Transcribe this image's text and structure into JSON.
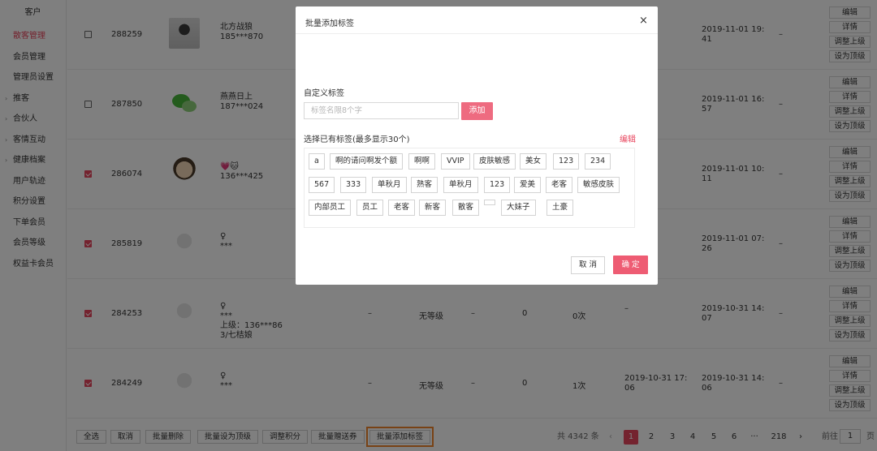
{
  "sidebar": {
    "title": "客户",
    "items": [
      {
        "label": "散客管理",
        "active": true,
        "has_arrow": false
      },
      {
        "label": "会员管理",
        "active": false,
        "has_arrow": false
      },
      {
        "label": "管理员设置",
        "active": false,
        "has_arrow": false
      },
      {
        "label": "推客",
        "active": false,
        "has_arrow": true
      },
      {
        "label": "合伙人",
        "active": false,
        "has_arrow": true
      },
      {
        "label": "客情互动",
        "active": false,
        "has_arrow": true
      },
      {
        "label": "健康档案",
        "active": false,
        "has_arrow": true
      },
      {
        "label": "用户轨迹",
        "active": false,
        "has_arrow": false
      },
      {
        "label": "积分设置",
        "active": false,
        "has_arrow": false
      },
      {
        "label": "下单会员",
        "active": false,
        "has_arrow": false
      },
      {
        "label": "会员等级",
        "active": false,
        "has_arrow": false
      },
      {
        "label": "权益卡会员",
        "active": false,
        "has_arrow": false
      }
    ]
  },
  "rows": [
    {
      "id": "288259",
      "checked": false,
      "avatar": "photo",
      "name": "北方战狼",
      "phone": "185***870",
      "parent": "",
      "parent2": "",
      "level": "",
      "col_a": "",
      "col_b": "",
      "col_c": "",
      "col_d": "",
      "date1": "",
      "date2_line1": "2019-11-01 19:",
      "date2_line2": "41",
      "tail": "–"
    },
    {
      "id": "287850",
      "checked": false,
      "avatar": "wechat",
      "name": "燕燕日上",
      "phone": "187***024",
      "parent": "",
      "parent2": "",
      "level": "",
      "col_a": "",
      "col_b": "",
      "col_c": "",
      "col_d": "",
      "date1": "",
      "date2_line1": "2019-11-01 16:",
      "date2_line2": "57",
      "tail": "–"
    },
    {
      "id": "286074",
      "checked": true,
      "avatar": "cartoon",
      "name": "💗🐱",
      "phone": "136***425",
      "parent": "",
      "parent2": "",
      "level": "",
      "col_a": "",
      "col_b": "",
      "col_c": "",
      "col_d": "",
      "date1": "",
      "date2_line1": "2019-11-01 10:",
      "date2_line2": "11",
      "tail": "–"
    },
    {
      "id": "285819",
      "checked": true,
      "avatar": "blank",
      "name": "♀",
      "phone": "***",
      "parent": "",
      "parent2": "",
      "level": "",
      "col_a": "",
      "col_b": "",
      "col_c": "",
      "col_d": "",
      "date1": "",
      "date2_line1": "2019-11-01 07:",
      "date2_line2": "26",
      "tail": "–"
    },
    {
      "id": "284253",
      "checked": true,
      "avatar": "blank",
      "name": "♀",
      "phone": "***",
      "parent": "上级：136***86",
      "parent2": "3/七桔娘",
      "level": "无等级",
      "col_a": "–",
      "col_b": "–",
      "col_c": "0",
      "col_d": "0次",
      "date1": "–",
      "date2_line1": "2019-10-31 14:",
      "date2_line2": "07",
      "tail": "–"
    },
    {
      "id": "284249",
      "checked": true,
      "avatar": "blank",
      "name": "♀",
      "phone": "***",
      "parent": "",
      "parent2": "",
      "level": "无等级",
      "col_a": "–",
      "col_b": "–",
      "col_c": "0",
      "col_d": "1次",
      "date1": "2019-10-31 17:",
      "date1_line2": "06",
      "date2_line1": "2019-10-31 14:",
      "date2_line2": "06",
      "tail": "–"
    }
  ],
  "row_ops": [
    "编辑",
    "详情",
    "调整上级",
    "设为顶级"
  ],
  "footer": {
    "buttons": [
      "全选",
      "取消",
      "批量删除",
      "批量设为顶级",
      "调整积分",
      "批量赠送券",
      "批量添加标签"
    ],
    "total": "共 4342 条",
    "prev": "‹",
    "pages": [
      "1",
      "2",
      "3",
      "4",
      "5",
      "6",
      "···",
      "218"
    ],
    "current_page": "1",
    "next": "›",
    "goto_label": "前往",
    "goto_value": "1",
    "page_suffix": "页"
  },
  "modal": {
    "title": "批量添加标签",
    "close": "×",
    "custom_label": "自定义标签",
    "input_placeholder": "标签名限8个字",
    "add_button": "添加",
    "existing_label": "选择已有标签(最多显示30个)",
    "edit_link": "编辑",
    "tags_row1": [
      "a",
      "啊的请问啊发个额",
      "啊啊",
      "VVIP",
      "皮肤敏感",
      "美女",
      "123",
      "234"
    ],
    "tags_row2": [
      "567",
      "333",
      "单秋月",
      "熟客",
      "单秋月",
      "123",
      "爱美",
      "老客",
      "敏感皮肤"
    ],
    "tags_row3": [
      "内部员工",
      "员工",
      "老客",
      "新客",
      "散客",
      "",
      "大妹子",
      "土豪"
    ],
    "cancel_button": "取 消",
    "ok_button": "确 定"
  },
  "colors": {
    "accent": "#e8475f",
    "highlight_outline": "#f0842b"
  }
}
